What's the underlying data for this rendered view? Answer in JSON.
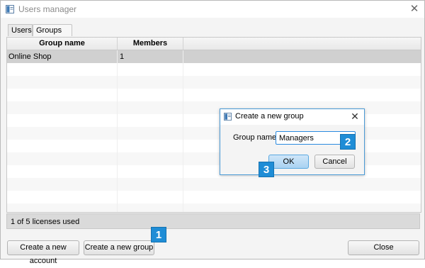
{
  "window": {
    "title": "Users manager",
    "close_glyph": "✕"
  },
  "tabs": [
    {
      "label": "Users",
      "active": false
    },
    {
      "label": "Groups",
      "active": true
    }
  ],
  "table": {
    "columns": [
      "Group name",
      "Members"
    ],
    "rows": [
      {
        "name": "Online Shop",
        "members": "1",
        "selected": true
      }
    ]
  },
  "status": {
    "text": "1 of 5 licenses used"
  },
  "buttons": {
    "create_account": "Create a new account",
    "create_group": "Create a new group",
    "close": "Close"
  },
  "dialog": {
    "title": "Create a new group",
    "close_glyph": "✕",
    "field_label": "Group name",
    "field_value": "Managers",
    "ok_label": "OK",
    "cancel_label": "Cancel"
  },
  "callouts": [
    "1",
    "2",
    "3"
  ],
  "colors": {
    "callout": "#1f8dd6",
    "selected_row": "#d0d0d0",
    "dialog_border": "#4a9ad6"
  },
  "icons": {
    "app": "app-window-icon",
    "dialog": "app-window-icon",
    "close": "close-icon"
  }
}
